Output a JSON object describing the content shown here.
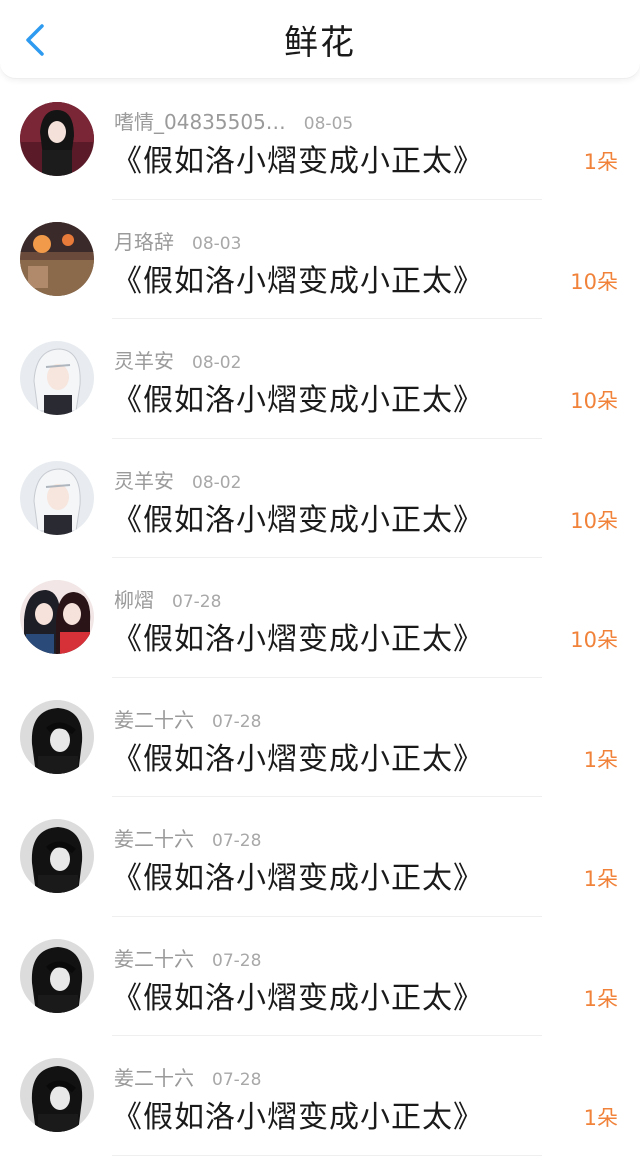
{
  "header": {
    "title": "鲜花",
    "back_icon": "chevron-left-icon"
  },
  "colors": {
    "accent_blue": "#2f9bf0",
    "amount_orange": "#f0823a"
  },
  "items": [
    {
      "user": "嗜情_04835505…",
      "date": "08-05",
      "book": "《假如洛小熠变成小正太》",
      "amount": "1朵",
      "avatar": "av1"
    },
    {
      "user": "月珞辞",
      "date": "08-03",
      "book": "《假如洛小熠变成小正太》",
      "amount": "10朵",
      "avatar": "av2"
    },
    {
      "user": "灵羊安",
      "date": "08-02",
      "book": "《假如洛小熠变成小正太》",
      "amount": "10朵",
      "avatar": "av3"
    },
    {
      "user": "灵羊安",
      "date": "08-02",
      "book": "《假如洛小熠变成小正太》",
      "amount": "10朵",
      "avatar": "av3"
    },
    {
      "user": "柳熠",
      "date": "07-28",
      "book": "《假如洛小熠变成小正太》",
      "amount": "10朵",
      "avatar": "av5"
    },
    {
      "user": "姜二十六",
      "date": "07-28",
      "book": "《假如洛小熠变成小正太》",
      "amount": "1朵",
      "avatar": "av6"
    },
    {
      "user": "姜二十六",
      "date": "07-28",
      "book": "《假如洛小熠变成小正太》",
      "amount": "1朵",
      "avatar": "av6"
    },
    {
      "user": "姜二十六",
      "date": "07-28",
      "book": "《假如洛小熠变成小正太》",
      "amount": "1朵",
      "avatar": "av6"
    },
    {
      "user": "姜二十六",
      "date": "07-28",
      "book": "《假如洛小熠变成小正太》",
      "amount": "1朵",
      "avatar": "av6"
    }
  ]
}
